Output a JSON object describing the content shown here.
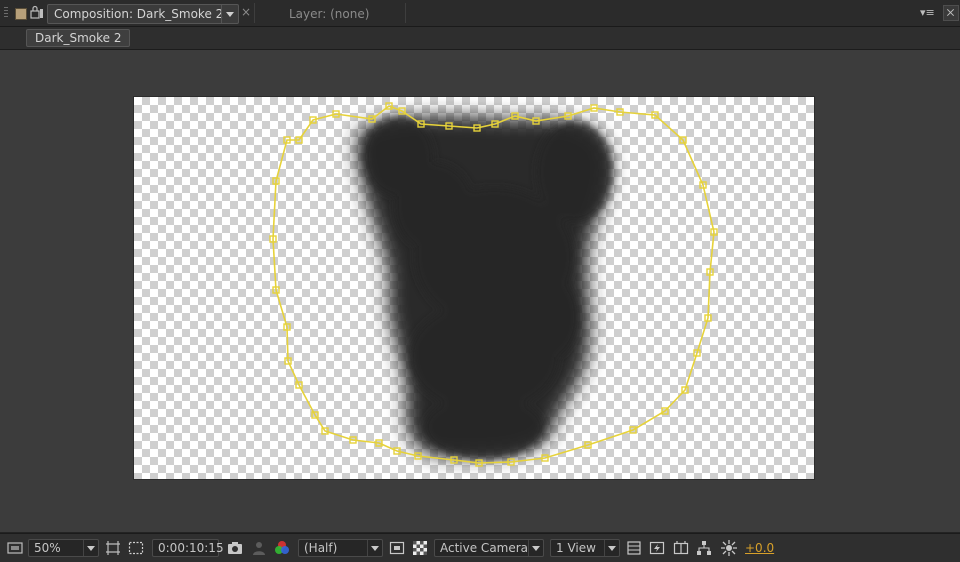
{
  "panel": {
    "comp_tab_title": "Composition: Dark_Smoke 2",
    "layer_tab_title": "Layer: (none)",
    "close_glyph": "×",
    "menu_glyph": "▾≡"
  },
  "breadcrumb": {
    "label": "Dark_Smoke 2"
  },
  "toolbar": {
    "magnification": "50%",
    "timecode": "0:00:10:15",
    "resolution": "(Half)",
    "camera": "Active Camera",
    "views": "1 View",
    "exposure": "+0.0"
  },
  "colors": {
    "mask_path": "#e6d23a",
    "label_swatch": "#b7a07a",
    "exposure_text": "#d7a02a",
    "smoke": "#2a2a2a"
  },
  "icons": [
    "panel-grip-icon",
    "label-color-icon",
    "lock-icon",
    "panel-menu-icon",
    "close-icon",
    "always-preview-icon",
    "grid-guide-icon",
    "toggle-mask-visibility-icon",
    "snapshot-icon",
    "show-snapshot-icon",
    "channel-rgb-icon",
    "region-of-interest-icon",
    "transparency-grid-icon",
    "fast-preview-icon",
    "timeline-icon",
    "comp-flowchart-icon",
    "reset-exposure-icon"
  ]
}
